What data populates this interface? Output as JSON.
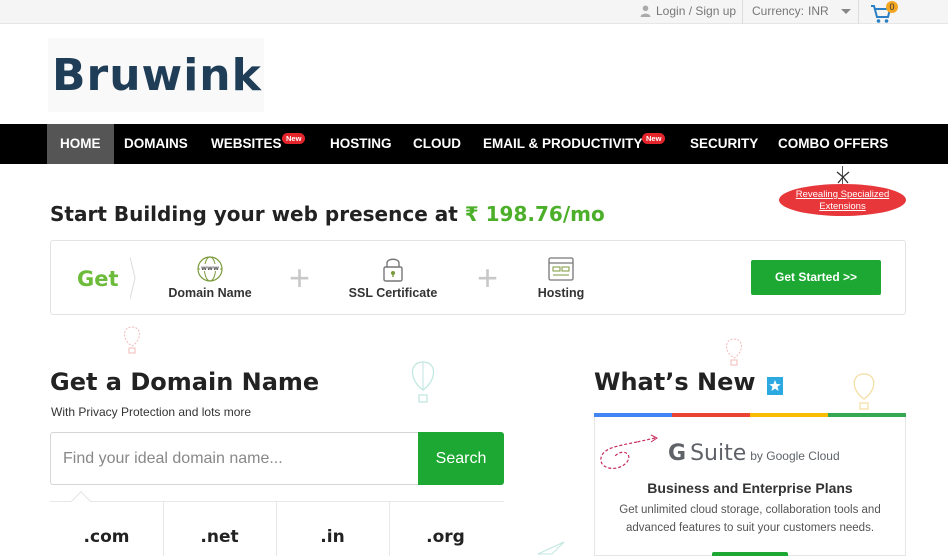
{
  "topbar": {
    "login_label": "Login / Sign up",
    "currency_label": "Currency:",
    "currency_value": "INR",
    "cart_count": "0"
  },
  "logo": {
    "text": "Bruwink"
  },
  "nav": {
    "items": [
      {
        "label": "HOME",
        "active": true
      },
      {
        "label": "DOMAINS"
      },
      {
        "label": "WEBSITES",
        "badge": "New"
      },
      {
        "label": "HOSTING"
      },
      {
        "label": "CLOUD"
      },
      {
        "label": "EMAIL & PRODUCTIVITY",
        "badge": "New"
      },
      {
        "label": "SECURITY"
      },
      {
        "label": "COMBO OFFERS"
      }
    ]
  },
  "offer_tag": {
    "line1": "Revealing Specialized",
    "line2": "Extensions"
  },
  "headline": {
    "text": "Start Building your web presence at",
    "price": "₹ 198.76/mo"
  },
  "offer_box": {
    "get_label": "Get",
    "features": [
      "Domain Name",
      "SSL Certificate",
      "Hosting"
    ],
    "cta": "Get Started >>"
  },
  "domain": {
    "title": "Get a Domain Name",
    "subtitle": "With Privacy Protection and lots more",
    "placeholder": "Find your ideal domain name...",
    "search_label": "Search",
    "tlds": [
      ".com",
      ".net",
      ".in",
      ".org"
    ]
  },
  "whats_new": {
    "title": "What’s New",
    "brand_g": "G",
    "brand_suite": "Suite",
    "brand_by": "by Google Cloud",
    "plans": "Business and Enterprise Plans",
    "description": "Get unlimited cloud storage, collaboration tools and advanced features to suit your customers needs.",
    "stripe_colors": [
      "#4285f4",
      "#ea4335",
      "#fbbc05",
      "#34a853"
    ]
  },
  "colors": {
    "accent_green": "#1ca832",
    "price_green": "#4caf2a",
    "nav_bg": "#000000",
    "badge_red": "#e3252b",
    "logo_navy": "#1f3d57"
  }
}
